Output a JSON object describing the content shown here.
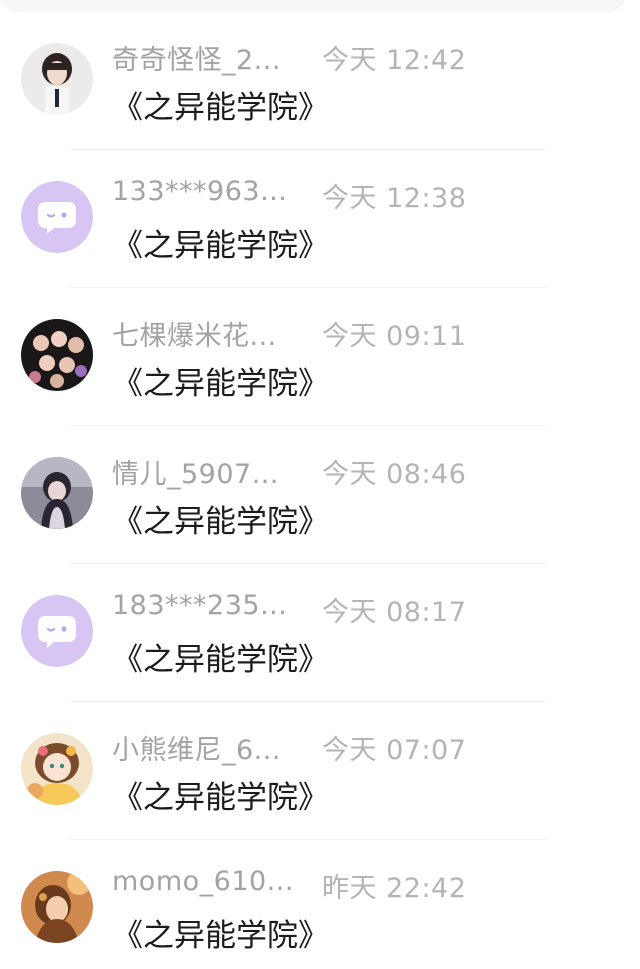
{
  "messages": [
    {
      "name": "奇奇怪怪_2...",
      "time": "今天 12:42",
      "text": "《之异能学院》",
      "avatar": "photo-girl"
    },
    {
      "name": "133***963...",
      "time": "今天 12:38",
      "text": "《之异能学院》",
      "avatar": "default-chat-bubble"
    },
    {
      "name": "七棵爆米花...",
      "time": "今天 09:11",
      "text": "《之异能学院》",
      "avatar": "photo-group"
    },
    {
      "name": "情儿_5907...",
      "time": "今天 08:46",
      "text": "《之异能学院》",
      "avatar": "photo-portrait"
    },
    {
      "name": "183***235...",
      "time": "今天 08:17",
      "text": "《之异能学院》",
      "avatar": "default-chat-bubble"
    },
    {
      "name": "小熊维尼_6...",
      "time": "今天 07:07",
      "text": "《之异能学院》",
      "avatar": "illustration-girl"
    },
    {
      "name": "momo_610...",
      "time": "昨天 22:42",
      "text": "《之异能学院》",
      "avatar": "illustration-portrait"
    }
  ],
  "colors": {
    "default_avatar_bg": "#d7c6f3",
    "name_text": "#a3a3a6",
    "time_text": "#b4b4b6",
    "message_text": "#1c1c1e"
  }
}
